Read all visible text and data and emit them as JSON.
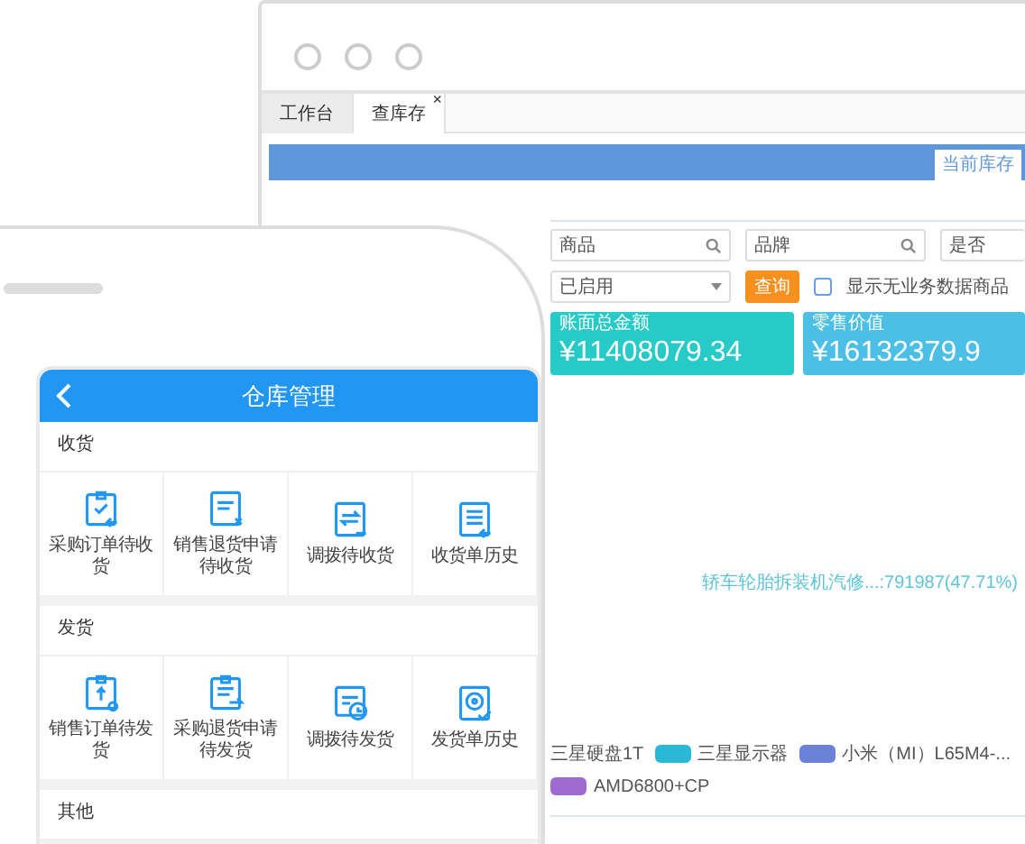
{
  "desktop": {
    "tabs": [
      {
        "label": "工作台",
        "selected": false
      },
      {
        "label": "查库存",
        "selected": true,
        "close_label": "×"
      }
    ],
    "subtab": {
      "label": "当前库存",
      "selected": true
    },
    "search_fields": [
      {
        "placeholder": "商品"
      },
      {
        "placeholder": "品牌"
      },
      {
        "placeholder": "是否"
      }
    ],
    "status_select": {
      "value": "已启用"
    },
    "query_button": "查询",
    "empty_goods_checkbox": {
      "label": "显示无业务数据商品",
      "checked": false
    },
    "stats": [
      {
        "label": "账面总金额",
        "value": "¥11408079.34",
        "color": "#26cbc8"
      },
      {
        "label": "零售价值",
        "value": "¥16132379.9",
        "color": "#4cbfe6"
      }
    ],
    "chart_label": "轿车轮胎拆装机汽修...:791987(47.71%)",
    "legend": [
      {
        "label": "三星硬盘1T"
      },
      {
        "label": "三星显示器",
        "color": "#2bb8d6"
      },
      {
        "label": "小米（MI）L65M4-...",
        "color": "#6b82d8"
      },
      {
        "label": "AMD6800+CP",
        "color": "#a06bd0"
      }
    ]
  },
  "phone": {
    "title": "仓库管理",
    "sections": [
      {
        "title": "收货",
        "items": [
          {
            "label": "采购订单待收货",
            "kind": "receive"
          },
          {
            "label": "销售退货申请待收货",
            "kind": "return"
          },
          {
            "label": "调拨待收货",
            "kind": "transfer"
          },
          {
            "label": "收货单历史",
            "kind": "history"
          }
        ]
      },
      {
        "title": "发货",
        "items": [
          {
            "label": "销售订单待发货",
            "kind": "ship"
          },
          {
            "label": "采购退货申请待发货",
            "kind": "sendback"
          },
          {
            "label": "调拨待发货",
            "kind": "dispatch"
          },
          {
            "label": "发货单历史",
            "kind": "record"
          }
        ]
      },
      {
        "title": "其他"
      }
    ]
  }
}
